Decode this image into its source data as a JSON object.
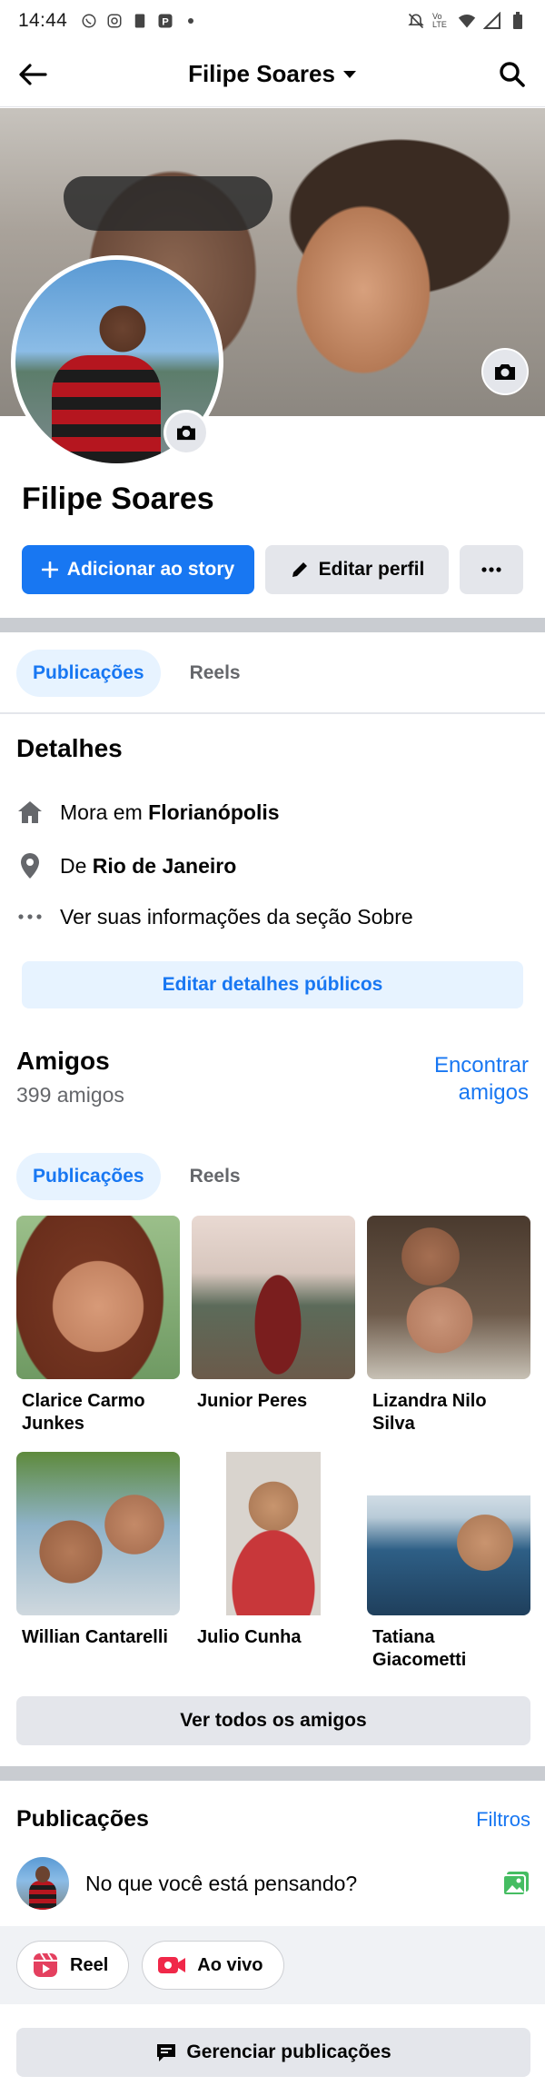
{
  "status_bar": {
    "time": "14:44",
    "network_label": "Vo LTE"
  },
  "nav": {
    "title": "Filipe Soares"
  },
  "profile": {
    "name": "Filipe Soares",
    "add_story_label": "Adicionar ao story",
    "edit_profile_label": "Editar perfil"
  },
  "tabs": [
    {
      "label": "Publicações",
      "active": true
    },
    {
      "label": "Reels",
      "active": false
    }
  ],
  "details": {
    "title": "Detalhes",
    "lives_prefix": "Mora em",
    "lives_city": "Florianópolis",
    "from_prefix": "De",
    "from_city": "Rio de Janeiro",
    "about_link": "Ver suas informações da seção Sobre",
    "edit_button": "Editar detalhes públicos"
  },
  "friends": {
    "title": "Amigos",
    "count": "399 amigos",
    "find_line1": "Encontrar",
    "find_line2": "amigos",
    "tabs": [
      {
        "label": "Publicações",
        "active": true
      },
      {
        "label": "Reels",
        "active": false
      }
    ],
    "list": [
      {
        "name": "Clarice Carmo Junkes"
      },
      {
        "name": "Junior Peres"
      },
      {
        "name": "Lizandra Nilo Silva"
      },
      {
        "name": "Willian Cantarelli"
      },
      {
        "name": "Julio Cunha"
      },
      {
        "name": "Tatiana Giacometti"
      }
    ],
    "see_all": "Ver todos os amigos"
  },
  "posts": {
    "title": "Publicações",
    "filters": "Filtros",
    "composer_prompt": "No que você está pensando?",
    "reel_label": "Reel",
    "live_label": "Ao vivo",
    "manage_label": "Gerenciar publicações"
  },
  "colors": {
    "accent": "#1877f2",
    "accent_light": "#e7f3ff",
    "button_gray": "#e4e6eb",
    "divider": "#c9ccd1",
    "secondary_text": "#65676b"
  }
}
